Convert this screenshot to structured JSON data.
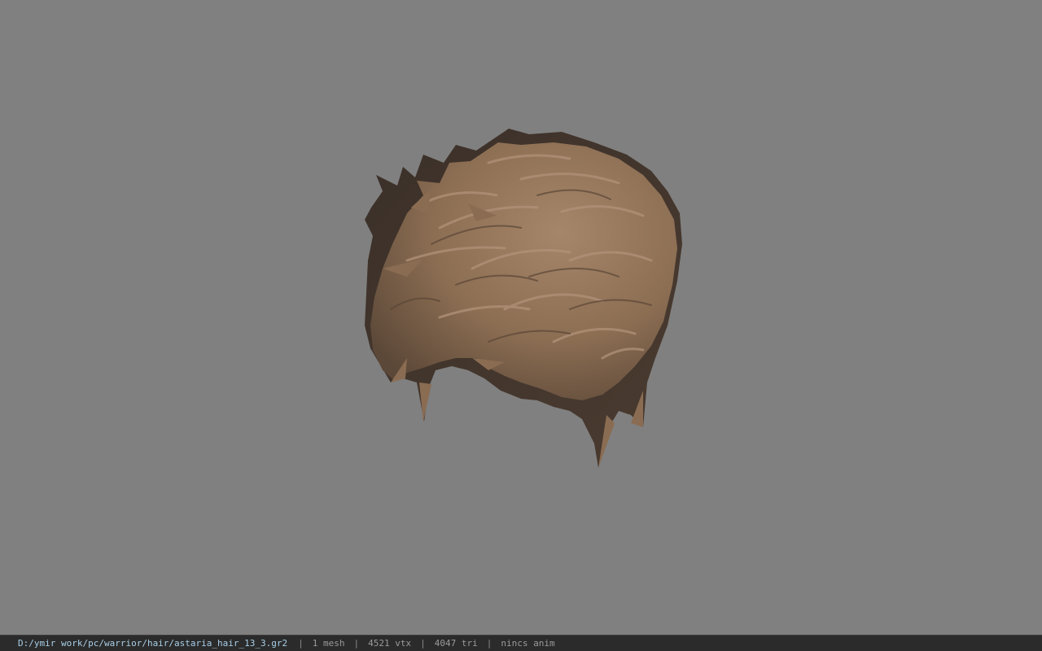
{
  "viewer": {
    "background_color": "#808080",
    "model": {
      "icon": "hair-mesh-model",
      "base_color": "#8f7256",
      "shadow_color": "#3f3329"
    }
  },
  "status_bar": {
    "file_path": "D:/ymir work/pc/warrior/hair/astaria_hair_13_3.gr2",
    "separator": "|",
    "mesh_count": "1 mesh",
    "vertex_count": "4521 vtx",
    "triangle_count": "4047 tri",
    "animation": "nincs anim"
  }
}
